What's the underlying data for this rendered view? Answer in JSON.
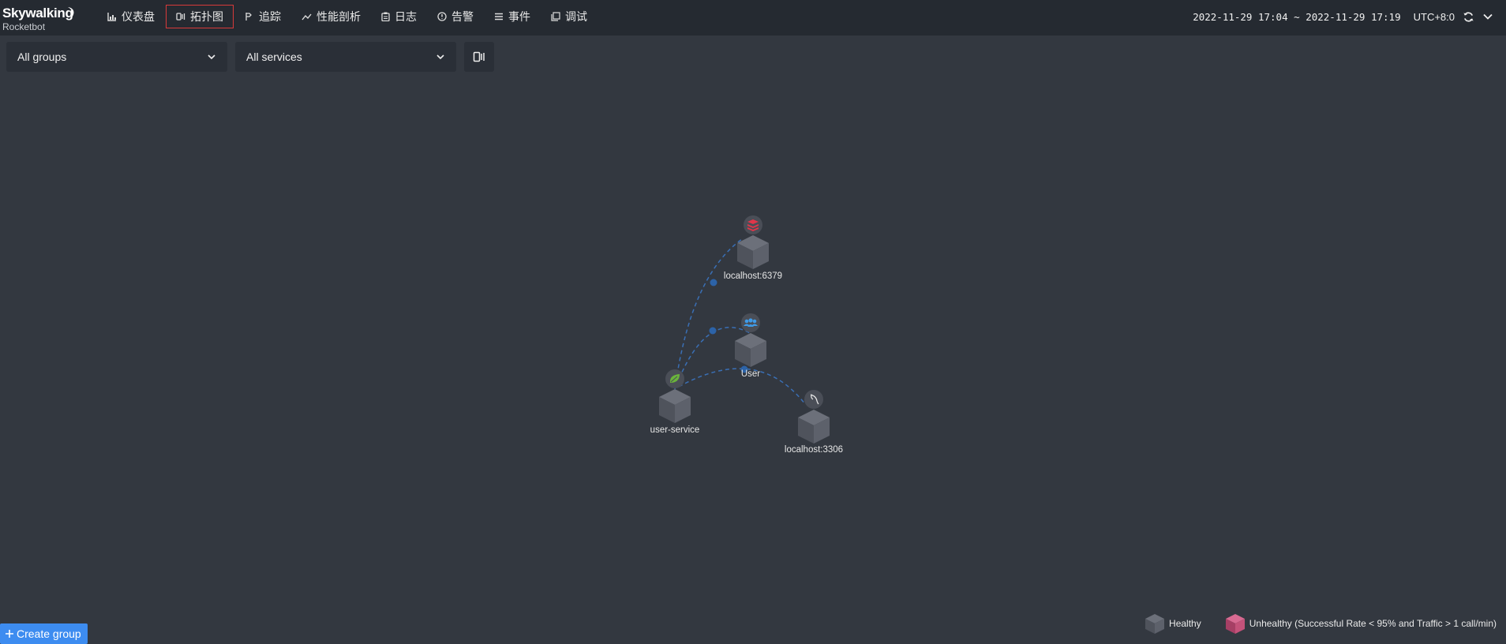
{
  "app": {
    "logo_name": "Skywalking",
    "logo_sub": "Rocketbot"
  },
  "nav": [
    {
      "label": "仪表盘",
      "icon": "bar-chart-icon"
    },
    {
      "label": "拓扑图",
      "icon": "topology-icon",
      "active": true
    },
    {
      "label": "追踪",
      "icon": "trace-flag-icon"
    },
    {
      "label": "性能剖析",
      "icon": "line-chart-icon"
    },
    {
      "label": "日志",
      "icon": "clipboard-icon"
    },
    {
      "label": "告警",
      "icon": "alert-clock-icon"
    },
    {
      "label": "事件",
      "icon": "list-icon"
    },
    {
      "label": "调试",
      "icon": "copy-icon"
    }
  ],
  "time": {
    "range": "2022-11-29 17:04 ~ 2022-11-29 17:19",
    "timezone": "UTC+8:0"
  },
  "filters": {
    "group": "All groups",
    "service": "All services"
  },
  "topology": {
    "nodes": [
      {
        "name": "localhost:6379",
        "type": "redis"
      },
      {
        "name": "User",
        "type": "user"
      },
      {
        "name": "user-service",
        "type": "spring"
      },
      {
        "name": "localhost:3306",
        "type": "mysql"
      }
    ],
    "links": [
      {
        "source": "user-service",
        "target": "localhost:6379"
      },
      {
        "source": "User",
        "target": "user-service"
      },
      {
        "source": "user-service",
        "target": "localhost:3306"
      }
    ]
  },
  "create_group": {
    "label": "Create group"
  },
  "legend": {
    "healthy": "Healthy",
    "unhealthy": "Unhealthy (Successful Rate < 95% and Traffic > 1 call/min)"
  },
  "colors": {
    "background": "#333840",
    "topbar": "#252a31",
    "active_border": "#d83a3a",
    "link": "#3a6fb5",
    "primary_button": "#3d8cf0",
    "unhealthy": "#c4527a"
  }
}
